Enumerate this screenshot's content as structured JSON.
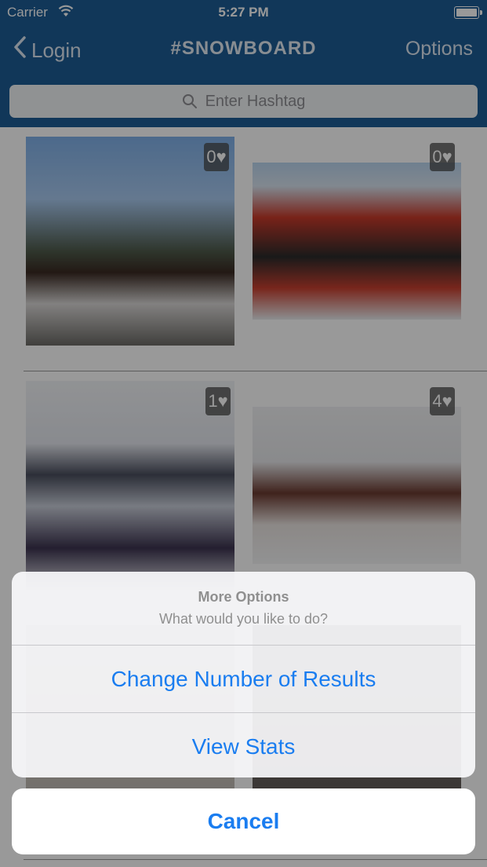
{
  "status_bar": {
    "carrier": "Carrier",
    "time": "5:27 PM"
  },
  "nav": {
    "back_label": "Login",
    "title": "#SNOWBOARD",
    "options_label": "Options"
  },
  "search": {
    "placeholder": "Enter Hashtag"
  },
  "posts": [
    {
      "likes": "0♥"
    },
    {
      "likes": "0♥"
    },
    {
      "likes": "1♥"
    },
    {
      "likes": "4♥"
    }
  ],
  "action_sheet": {
    "title": "More Options",
    "message": "What would you like to do?",
    "buttons": [
      "Change Number of Results",
      "View Stats"
    ],
    "cancel_label": "Cancel"
  },
  "colors": {
    "nav_bar": "#1d5c95",
    "action_text": "#1a7df0"
  }
}
